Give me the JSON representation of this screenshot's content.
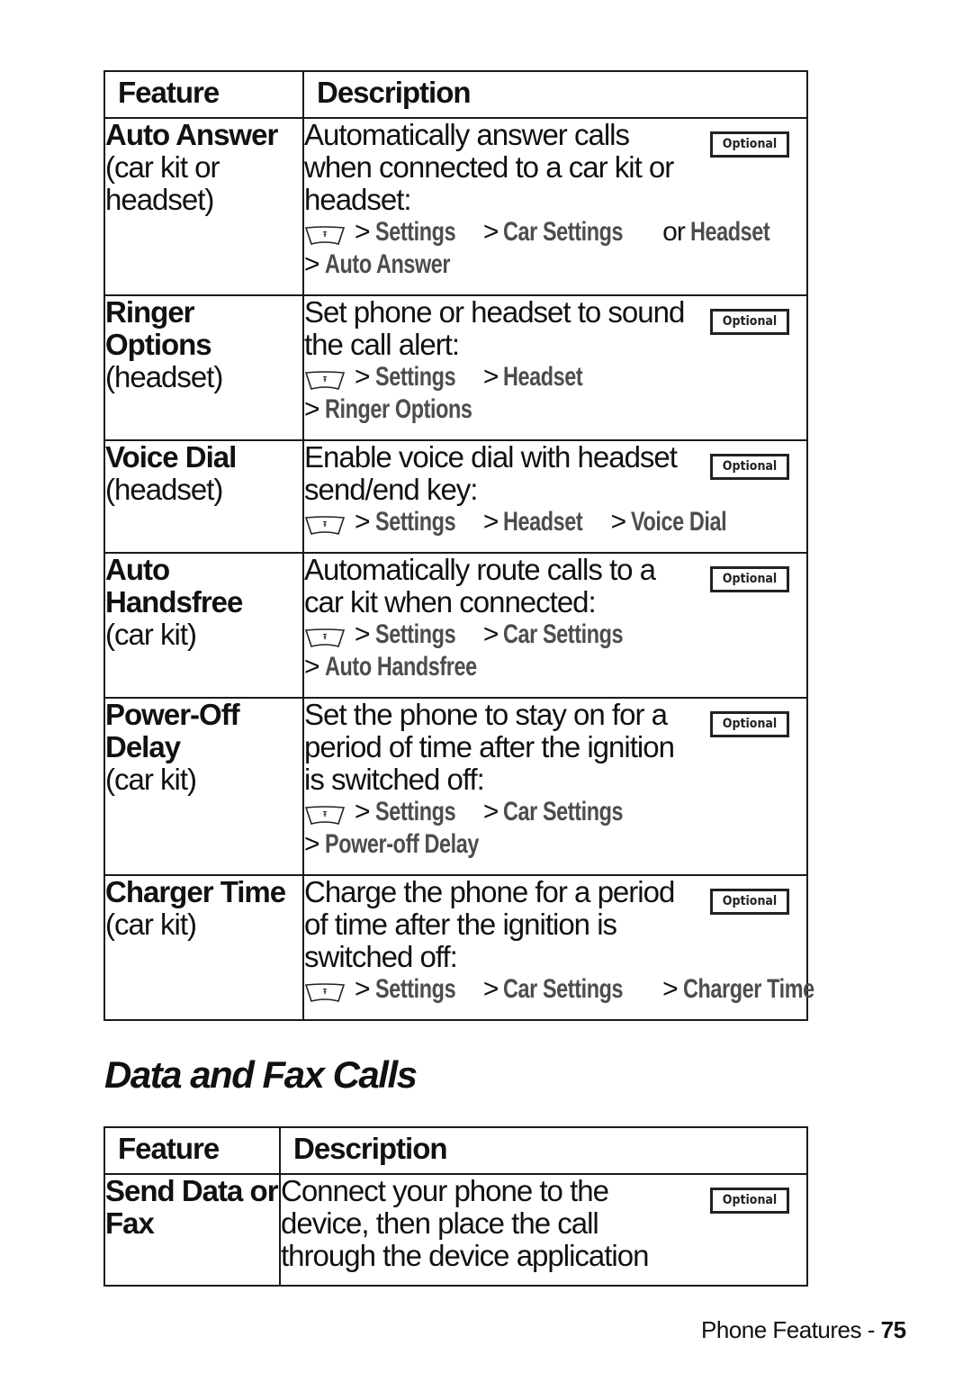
{
  "table1": {
    "headers": {
      "feature": "Feature",
      "description": "Description"
    },
    "badge_label": "Optional",
    "rows": [
      {
        "name": "Auto Answer",
        "note": "(car kit or headset)",
        "description": "Automatically answer calls when connected to a car kit or headset:",
        "path_line1": [
          "Settings",
          "Car Settings"
        ],
        "path_or": "or",
        "path_alt": "Headset",
        "path_line2": [
          "Auto Answer"
        ]
      },
      {
        "name": "Ringer Options",
        "note": "(headset)",
        "description": "Set phone or headset to sound the call alert:",
        "path_line1": [
          "Settings",
          "Headset"
        ],
        "path_line2": [
          "Ringer Options"
        ]
      },
      {
        "name": "Voice Dial",
        "note": "(headset)",
        "description": "Enable voice dial with headset send/end key:",
        "path_line1": [
          "Settings",
          "Headset",
          "Voice Dial"
        ]
      },
      {
        "name": "Auto Handsfree",
        "note": "(car kit)",
        "description": "Automatically route calls to a car kit when connected:",
        "path_line1": [
          "Settings",
          "Car Settings"
        ],
        "path_line2": [
          "Auto Handsfree"
        ]
      },
      {
        "name": "Power-Off Delay",
        "note": "(car kit)",
        "description": "Set the phone to stay on for a period of time after the ignition is switched off:",
        "path_line1": [
          "Settings",
          "Car Settings"
        ],
        "path_line2": [
          "Power-off Delay"
        ]
      },
      {
        "name": "Charger Time",
        "note": "(car kit)",
        "description": "Charge the phone for a period of time after the ignition is switched off:",
        "path_line1": [
          "Settings",
          "Car Settings",
          "Charger Time"
        ]
      }
    ]
  },
  "section": {
    "title": "Data and Fax Calls"
  },
  "table2": {
    "headers": {
      "feature": "Feature",
      "description": "Description"
    },
    "badge_label": "Optional",
    "rows": [
      {
        "name": "Send Data or Fax",
        "description": "Connect your phone to the device, then place the call through the device application"
      }
    ]
  },
  "footer": {
    "section": "Phone Features - ",
    "page": "75"
  },
  "icons": {
    "menu_key": "menu-key-icon",
    "separator": ">"
  },
  "colors": {
    "menu_item": "#4d4d4d",
    "text": "#111111",
    "border": "#1a1a1a"
  }
}
